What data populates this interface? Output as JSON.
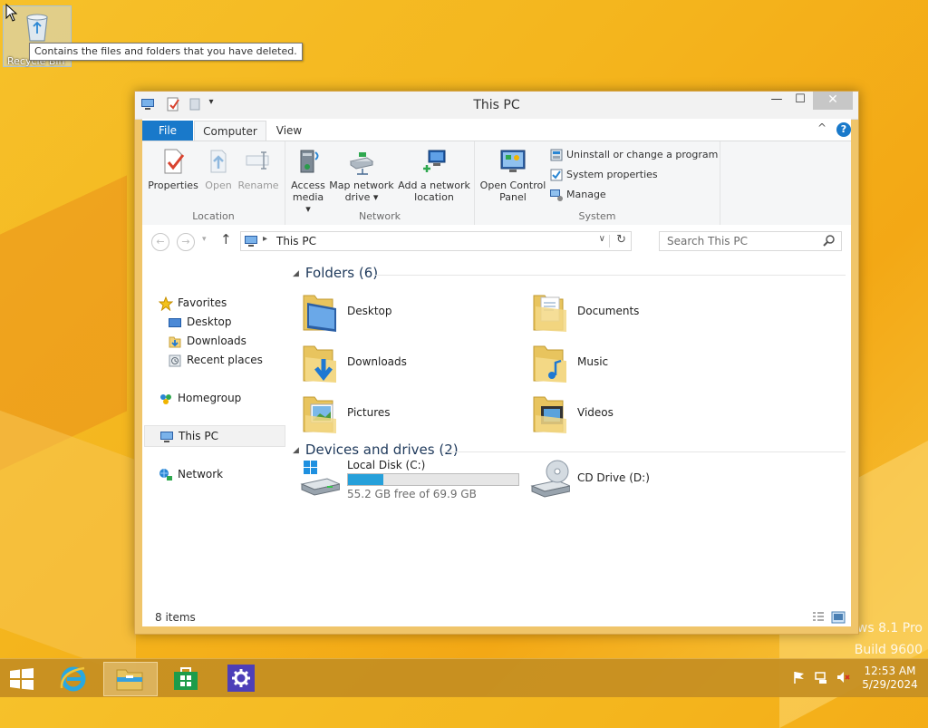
{
  "desktop": {
    "recycle_bin_label": "Recycle Bin",
    "tooltip": "Contains the files and folders that you have deleted.",
    "watermark_line1": "ws 8.1 Pro",
    "watermark_line2": "Build 9600"
  },
  "window": {
    "title": "This PC",
    "controls": {
      "minimize": "—",
      "maximize": "☐",
      "close": "✕"
    }
  },
  "ribbon": {
    "tabs": {
      "file": "File",
      "computer": "Computer",
      "view": "View"
    },
    "collapse": "^",
    "help": "?",
    "groups": {
      "location": {
        "label": "Location",
        "properties": "Properties",
        "open": "Open",
        "rename": "Rename"
      },
      "network": {
        "label": "Network",
        "access_media_l1": "Access",
        "access_media_l2": "media ▾",
        "map_drive_l1": "Map network",
        "map_drive_l2": "drive ▾",
        "add_location_l1": "Add a network",
        "add_location_l2": "location"
      },
      "system": {
        "label": "System",
        "control_panel_l1": "Open Control",
        "control_panel_l2": "Panel",
        "uninstall": "Uninstall or change a program",
        "system_properties": "System properties",
        "manage": "Manage"
      }
    }
  },
  "address_bar": {
    "path": "This PC",
    "search_placeholder": "Search This PC"
  },
  "nav_pane": {
    "favorites": "Favorites",
    "desktop": "Desktop",
    "downloads": "Downloads",
    "recent_places": "Recent places",
    "homegroup": "Homegroup",
    "this_pc": "This PC",
    "network": "Network"
  },
  "content": {
    "folders_header": "Folders (6)",
    "folders": [
      "Desktop",
      "Documents",
      "Downloads",
      "Music",
      "Pictures",
      "Videos"
    ],
    "devices_header": "Devices and drives (2)",
    "drives": [
      {
        "name": "Local Disk (C:)",
        "free_text": "55.2 GB free of 69.9 GB",
        "used_fraction": 0.21
      },
      {
        "name": "CD Drive (D:)"
      }
    ]
  },
  "status_bar": {
    "items": "8 items"
  },
  "taskbar": {
    "clock_time": "12:53 AM",
    "clock_date": "5/29/2024"
  },
  "colors": {
    "accent": "#1979ca",
    "drive_fill": "#26a0da",
    "taskbar": "#c48e22"
  }
}
